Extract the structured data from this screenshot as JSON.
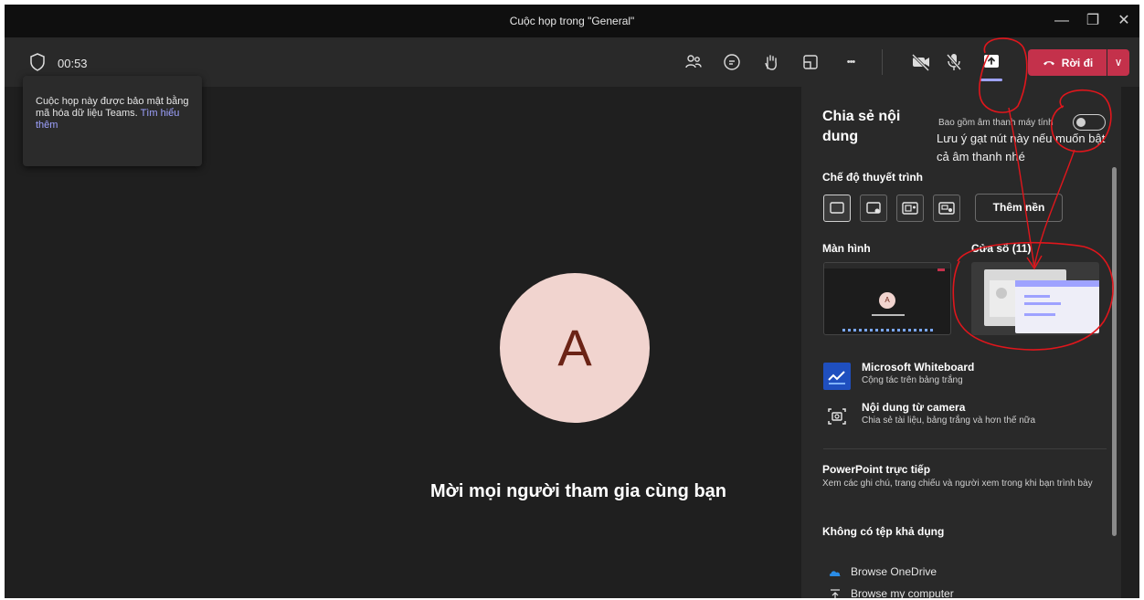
{
  "window": {
    "title": "Cuộc họp trong \"General\"",
    "minimize_glyph": "—",
    "maximize_glyph": "❐",
    "close_glyph": "✕"
  },
  "toolbar": {
    "shield_icon": "shield-icon",
    "timer": "00:53",
    "icons": [
      "people-icon",
      "chat-icon",
      "raise-hand-icon",
      "rooms-icon",
      "more-icon",
      "camera-off-icon",
      "mic-off-icon",
      "share-screen-icon"
    ],
    "more_glyph": "•••",
    "leave_label": "Rời đi",
    "leave_chevron": "∨",
    "leave_color": "#c4314b",
    "share_active_color": "#9ea2ff"
  },
  "tooltip": {
    "text": "Cuộc họp này được bảo mật bằng mã hóa dữ liệu Teams.",
    "link": "Tìm hiểu thêm"
  },
  "stage": {
    "avatar_initial": "A",
    "avatar_bg": "#f1d4cf",
    "invite_text": "Mời mọi người tham gia cùng bạn"
  },
  "share_panel": {
    "title": "Chia sẻ nội dung",
    "include_audio_label": "Bao gồm âm thanh máy tính",
    "include_audio_on": false,
    "annotation": "Lưu ý gạt nút này nếu muốn bật cả âm thanh nhé",
    "presenter_mode_label": "Chế độ thuyết trình",
    "presenter_modes": [
      "content-only-icon",
      "standout-icon",
      "side-by-side-icon",
      "reporter-icon"
    ],
    "background_button": "Thêm nền",
    "screen_label": "Màn hình",
    "window_label": "Cửa sổ (11)",
    "screen_thumb_initial": "A",
    "apps": [
      {
        "title": "Microsoft Whiteboard",
        "subtitle": "Cộng tác trên bảng trắng",
        "icon": "whiteboard-icon"
      },
      {
        "title": "Nội dung từ camera",
        "subtitle": "Chia sẻ tài liệu, bảng trắng và hơn thế nữa",
        "icon": "camera-content-icon"
      }
    ],
    "powerpoint_title": "PowerPoint trực tiếp",
    "powerpoint_desc": "Xem các ghi chú, trang chiếu và người xem trong khi bạn trình bày",
    "no_files": "Không có tệp khả dụng",
    "browse": [
      {
        "label": "Browse OneDrive",
        "icon": "onedrive-icon"
      },
      {
        "label": "Browse my computer",
        "icon": "upload-icon"
      }
    ]
  }
}
